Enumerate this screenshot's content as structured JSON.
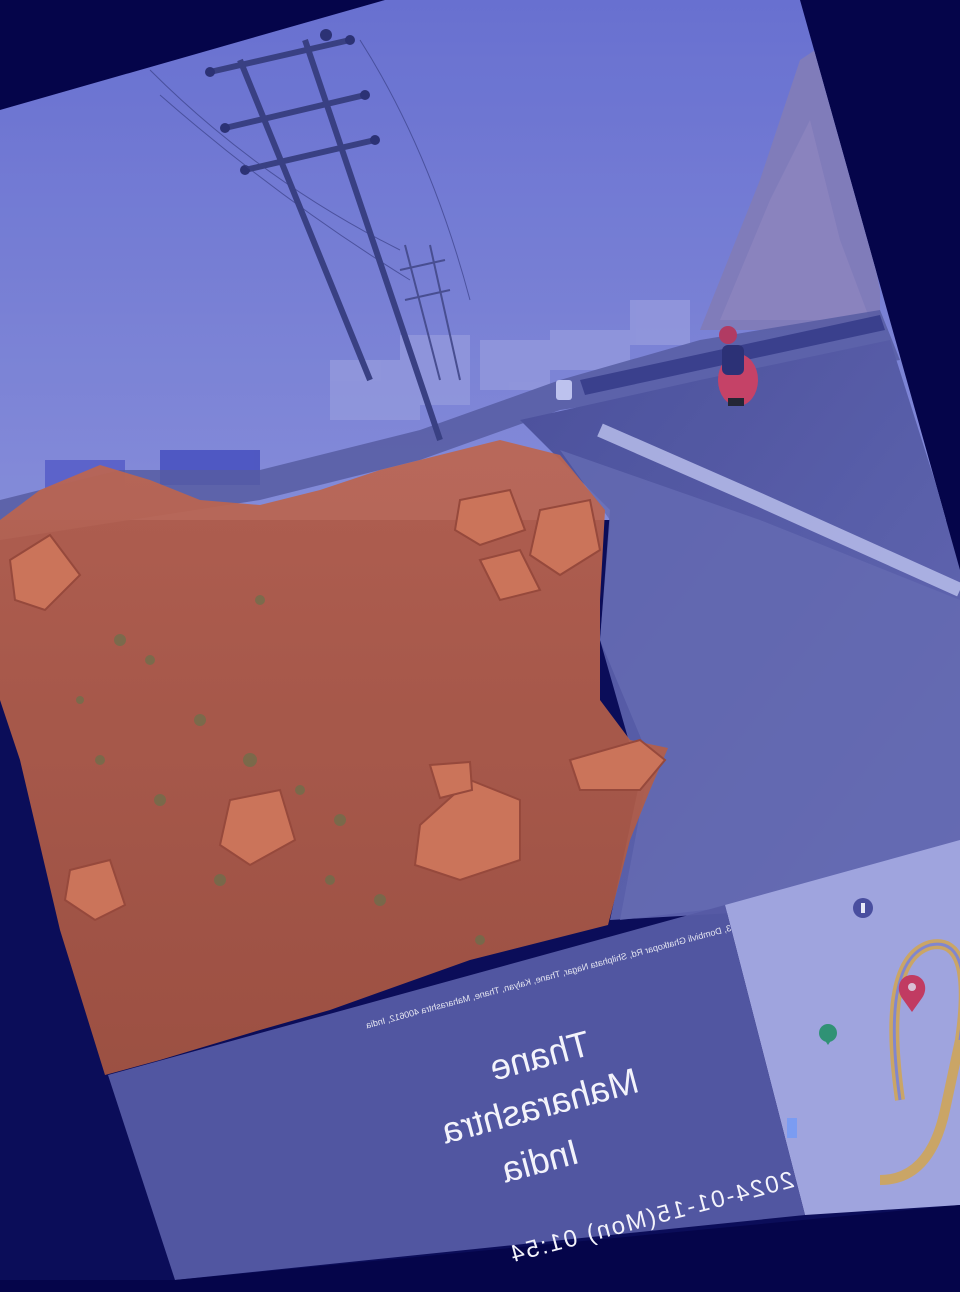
{
  "colors": {
    "background": "#05054a",
    "overlay_tint": "#4a52c8",
    "segmentation_mask": "#d9663a",
    "sky": "#7f86d8",
    "road": "#5d61a6",
    "stamp_panel": "#5a5da0"
  },
  "segmentation": {
    "class": "",
    "highlighted_region": "rocky soil foreground"
  },
  "stamp": {
    "address": "3, Dombivli Ghatkopar Rd, Shilphata Nagar, Thane, Kalyan, Thane, Maharashtra 400612, India",
    "city": "Thane",
    "state": "Maharashtra",
    "country": "India",
    "datetime": "2024-01-15(Mon) 01:54"
  },
  "map": {
    "pin": "map-pin-icon",
    "place_icon": "place-marker-icon"
  }
}
